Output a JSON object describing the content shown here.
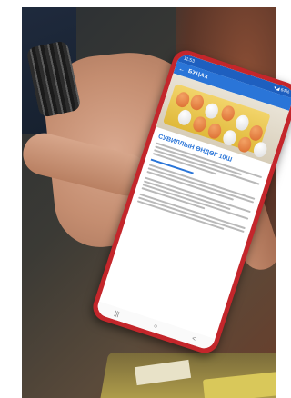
{
  "phone": {
    "status_time": "11:53",
    "status_right": "▾◢ 64%",
    "app_title": "БУЦАХ",
    "back_icon": "arrow-left-icon",
    "product_title": "СУВИЛЛЫН ӨНДӨГ 10ш",
    "nav": [
      "|||",
      "○",
      "<"
    ]
  }
}
